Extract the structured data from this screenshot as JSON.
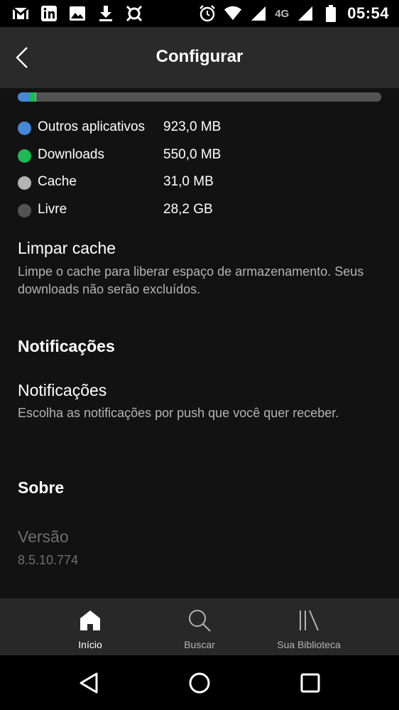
{
  "status_bar": {
    "time": "05:54",
    "network": "4G",
    "left_icons": [
      "gmail-icon",
      "linkedin-icon",
      "gallery-icon",
      "download-icon",
      "app-icon"
    ],
    "right_icons": [
      "alarm-icon",
      "wifi-icon",
      "signal-icon",
      "signal-icon",
      "battery-icon"
    ]
  },
  "header": {
    "title": "Configurar"
  },
  "storage": {
    "bar": [
      {
        "name": "Outros aplicativos",
        "fraction": 0.031,
        "color": "#4687d6"
      },
      {
        "name": "Downloads",
        "fraction": 0.018,
        "color": "#1db954"
      },
      {
        "name": "Cache",
        "fraction": 0.001,
        "color": "#b3b3b3"
      },
      {
        "name": "Livre",
        "fraction": 0.95,
        "color": "#535353"
      }
    ],
    "legend": [
      {
        "label": "Outros aplicativos",
        "value": "923,0 MB",
        "color": "#4687d6"
      },
      {
        "label": "Downloads",
        "value": "550,0 MB",
        "color": "#1db954"
      },
      {
        "label": "Cache",
        "value": "31,0 MB",
        "color": "#b3b3b3"
      },
      {
        "label": "Livre",
        "value": "28,2 GB",
        "color": "#535353"
      }
    ]
  },
  "clear_cache": {
    "title": "Limpar cache",
    "description": "Limpe o cache para liberar espaço de armazenamento. Seus downloads não serão excluídos."
  },
  "notifications_section": {
    "heading": "Notificações",
    "item_title": "Notificações",
    "item_description": "Escolha as notificações por push que você quer receber."
  },
  "about_section": {
    "heading": "Sobre",
    "version_title": "Versão",
    "version_value": "8.5.10.774"
  },
  "tabs": [
    {
      "label": "Início",
      "icon": "home-icon",
      "active": true
    },
    {
      "label": "Buscar",
      "icon": "search-icon",
      "active": false
    },
    {
      "label": "Sua Biblioteca",
      "icon": "library-icon",
      "active": false
    }
  ],
  "colors": {
    "active_tab": "#ffffff",
    "inactive_tab": "#b3b3b3"
  }
}
